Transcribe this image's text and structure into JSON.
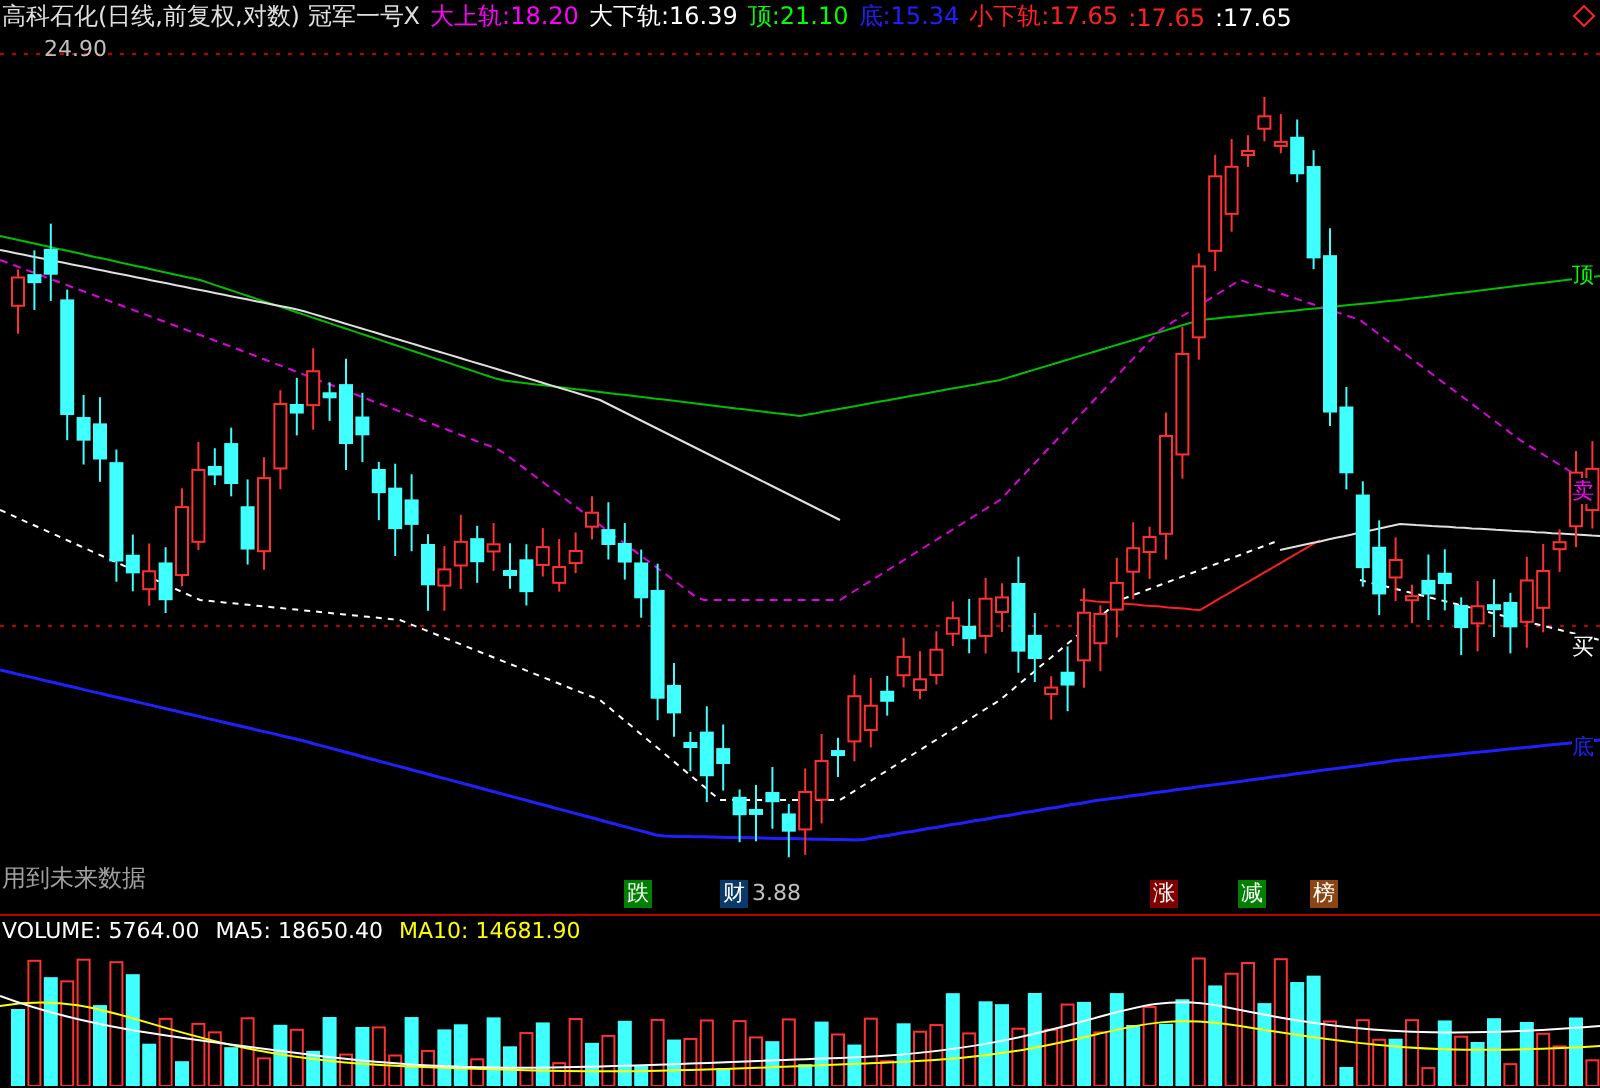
{
  "header": {
    "title": "高科石化(日线,前复权,对数) 冠军一号X",
    "indicators": [
      {
        "label": "大上轨:",
        "value": "18.20",
        "color": "#ff00ff"
      },
      {
        "label": "大下轨:",
        "value": "16.39",
        "color": "#ffffff"
      },
      {
        "label": "顶:",
        "value": "21.10",
        "color": "#00ff00"
      },
      {
        "label": "底:",
        "value": "15.34",
        "color": "#2020ff"
      },
      {
        "label": "小下轨:",
        "value": "17.65",
        "color": "#ff2020"
      },
      {
        "label": ":",
        "value": "17.65",
        "color": "#ff2020"
      },
      {
        "label": ":",
        "value": "17.65",
        "color": "#ffffff"
      }
    ]
  },
  "price_labels": {
    "high": "24.90",
    "low": "3.88"
  },
  "right_labels": [
    {
      "text": "顶",
      "color": "#00ff00"
    },
    {
      "text": "卖",
      "color": "#ff00ff"
    },
    {
      "text": "买",
      "color": "#ffffff"
    },
    {
      "text": "底",
      "color": "#2020ff"
    }
  ],
  "note": "用到未来数据",
  "signals": [
    {
      "text": "跌",
      "color": "#008000"
    },
    {
      "text": "财",
      "color": "#0a3a6a"
    },
    {
      "text": "涨",
      "color": "#800000"
    },
    {
      "text": "减",
      "color": "#008000"
    },
    {
      "text": "榜",
      "color": "#8b4513"
    }
  ],
  "volume_header": [
    {
      "label": "VOLUME:",
      "value": "5764.00",
      "color": "#ffffff"
    },
    {
      "label": "MA5:",
      "value": "18650.40",
      "color": "#ffffff"
    },
    {
      "label": "MA10:",
      "value": "14681.90",
      "color": "#ffff00"
    }
  ]
}
